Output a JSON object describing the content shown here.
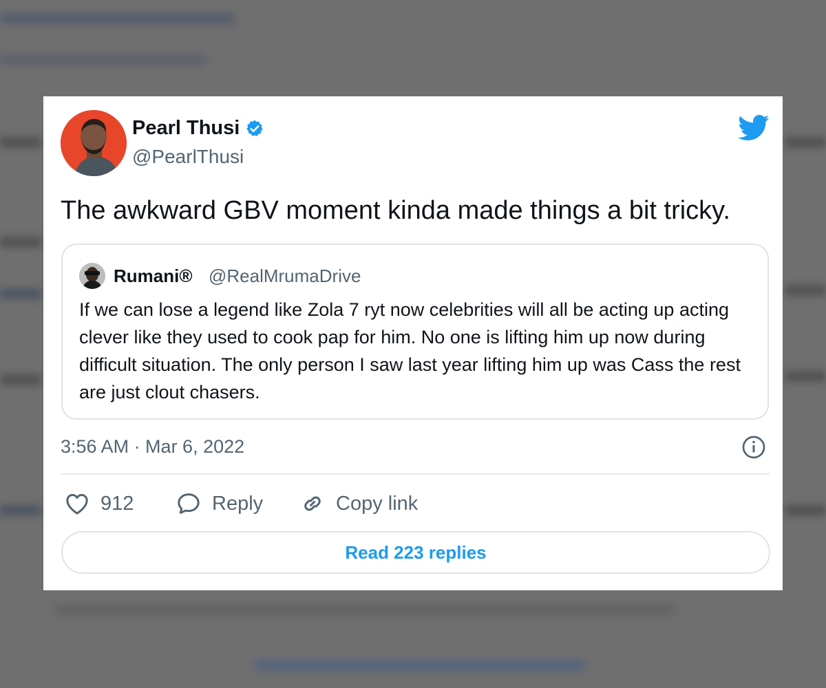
{
  "tweet": {
    "author_name": "Pearl Thusi",
    "author_handle": "@PearlThusi",
    "text": "The awkward GBV moment kinda made things a bit tricky.",
    "timestamp": "3:56 AM · Mar 6, 2022",
    "verified": true
  },
  "quoted_tweet": {
    "author_name": "Rumani®",
    "author_handle": "@RealMrumaDrive",
    "text": "If we can lose a legend like Zola 7 ryt now celebrities will all be acting up acting clever like they used to cook pap for him. No one is lifting him up now during difficult situation. The only person I saw last year lifting him up was Cass the rest are just clout chasers."
  },
  "actions": {
    "like_count": "912",
    "reply_label": "Reply",
    "copy_link_label": "Copy link",
    "read_replies_label": "Read 223 replies"
  },
  "colors": {
    "accent": "#1d9bf0",
    "text_primary": "#0f1419",
    "text_secondary": "#536471",
    "avatar_bg": "#e8462b"
  },
  "icons": {
    "brand": "twitter-bird-icon",
    "verified": "verified-badge-icon",
    "info": "info-icon",
    "like": "heart-icon",
    "reply": "speech-bubble-icon",
    "copy_link": "link-icon"
  }
}
